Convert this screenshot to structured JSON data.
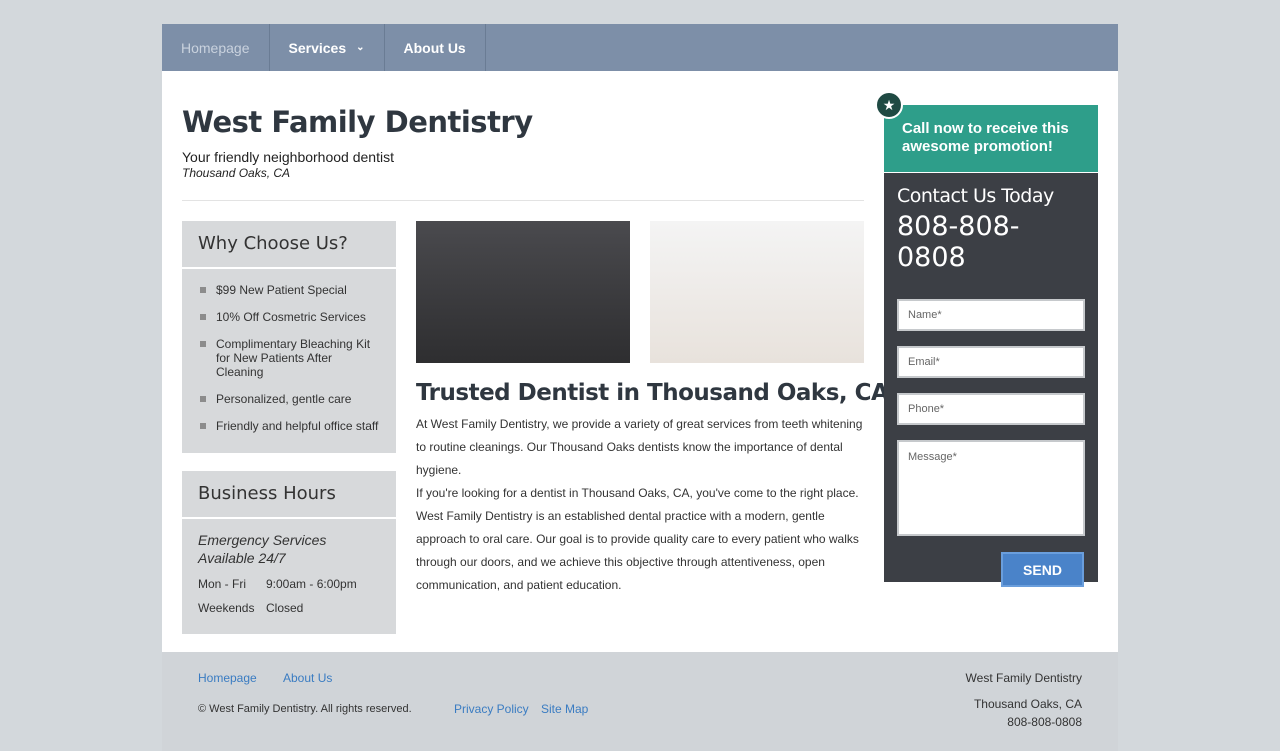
{
  "nav": {
    "items": [
      {
        "label": "Homepage"
      },
      {
        "label": "Services"
      },
      {
        "label": "About Us"
      }
    ]
  },
  "header": {
    "title": "West Family Dentistry",
    "tagline": "Your friendly neighborhood dentist",
    "location": "Thousand Oaks, CA"
  },
  "why": {
    "heading": "Why Choose Us?",
    "items": [
      "$99 New Patient Special",
      "10% Off Cosmetric Services",
      "Complimentary Bleaching Kit for New Patients After Cleaning",
      "Personalized, gentle care",
      "Friendly and helpful office staff"
    ]
  },
  "hours": {
    "heading": "Business Hours",
    "emergency": "Emergency Services Available 24/7",
    "rows": [
      {
        "days": "Mon - Fri",
        "time": "9:00am - 6:00pm"
      },
      {
        "days": "Weekends",
        "time": "Closed"
      }
    ]
  },
  "content": {
    "heading": "Trusted Dentist in Thousand Oaks, CA",
    "p1": "At West Family Dentistry, we provide a variety of great services from teeth whitening to routine cleanings. Our Thousand Oaks dentists know the importance of dental hygiene.",
    "p2": "If you're looking for a dentist in Thousand Oaks, CA, you've come to the right place. West Family Dentistry is an established dental practice with a modern, gentle approach to oral care. Our goal is to provide quality care to every patient who walks through our doors, and we achieve this objective through attentiveness, open communication, and patient education."
  },
  "promo": {
    "text": "Call now to receive this awesome promotion!",
    "icon": "star-icon"
  },
  "contact": {
    "heading": "Contact Us Today",
    "phone": "808-808-0808",
    "name_placeholder": "Name*",
    "email_placeholder": "Email*",
    "phone_placeholder": "Phone*",
    "message_placeholder": "Message*",
    "send_label": "SEND"
  },
  "footer": {
    "links": [
      "Homepage",
      "About Us"
    ],
    "copyright": "© West Family Dentistry. All rights reserved.",
    "legal_links": [
      "Privacy Policy",
      "Site Map"
    ],
    "business_name": "West Family Dentistry",
    "city": "Thousand Oaks, CA",
    "phone": "808-808-0808"
  },
  "colors": {
    "nav": "#7d8fa8",
    "promo": "#2e9e8a",
    "contact_panel": "#3c3f45",
    "send_button": "#4a83c9",
    "link": "#3a7cc2"
  }
}
